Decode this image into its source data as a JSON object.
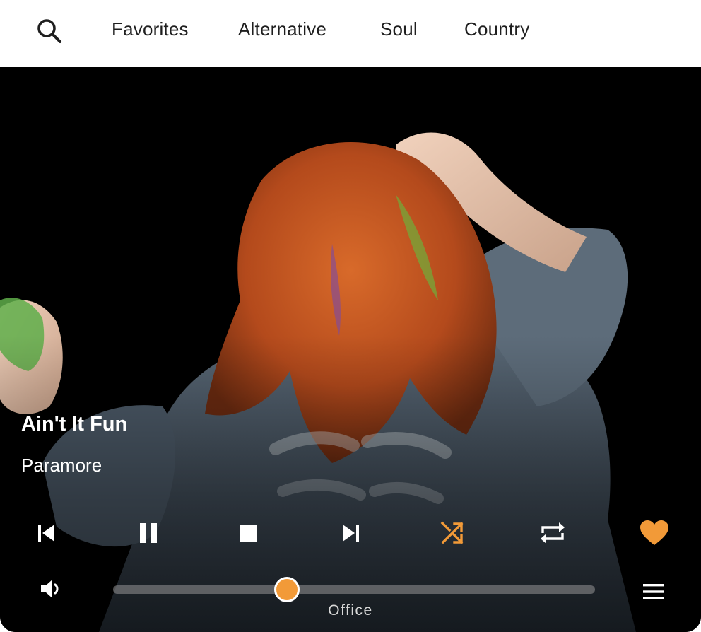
{
  "nav": {
    "search_icon": "search-icon",
    "tabs": [
      {
        "label": "Favorites"
      },
      {
        "label": "Alternative"
      },
      {
        "label": "Soul"
      },
      {
        "label": "Country"
      }
    ]
  },
  "now_playing": {
    "title": "Ain't It Fun",
    "artist": "Paramore",
    "room": "Office",
    "volume_level": 0.36
  },
  "controls": {
    "previous_icon": "skip-previous-icon",
    "pause_icon": "pause-icon",
    "stop_icon": "stop-icon",
    "next_icon": "skip-next-icon",
    "shuffle_icon": "shuffle-icon",
    "repeat_icon": "repeat-icon",
    "favorite_icon": "heart-icon",
    "volume_icon": "volume-icon",
    "menu_icon": "menu-icon"
  },
  "colors": {
    "accent": "#f29a38",
    "icon": "#ffffff",
    "nav_text": "#1f1f1f",
    "background_art": "#000000"
  }
}
